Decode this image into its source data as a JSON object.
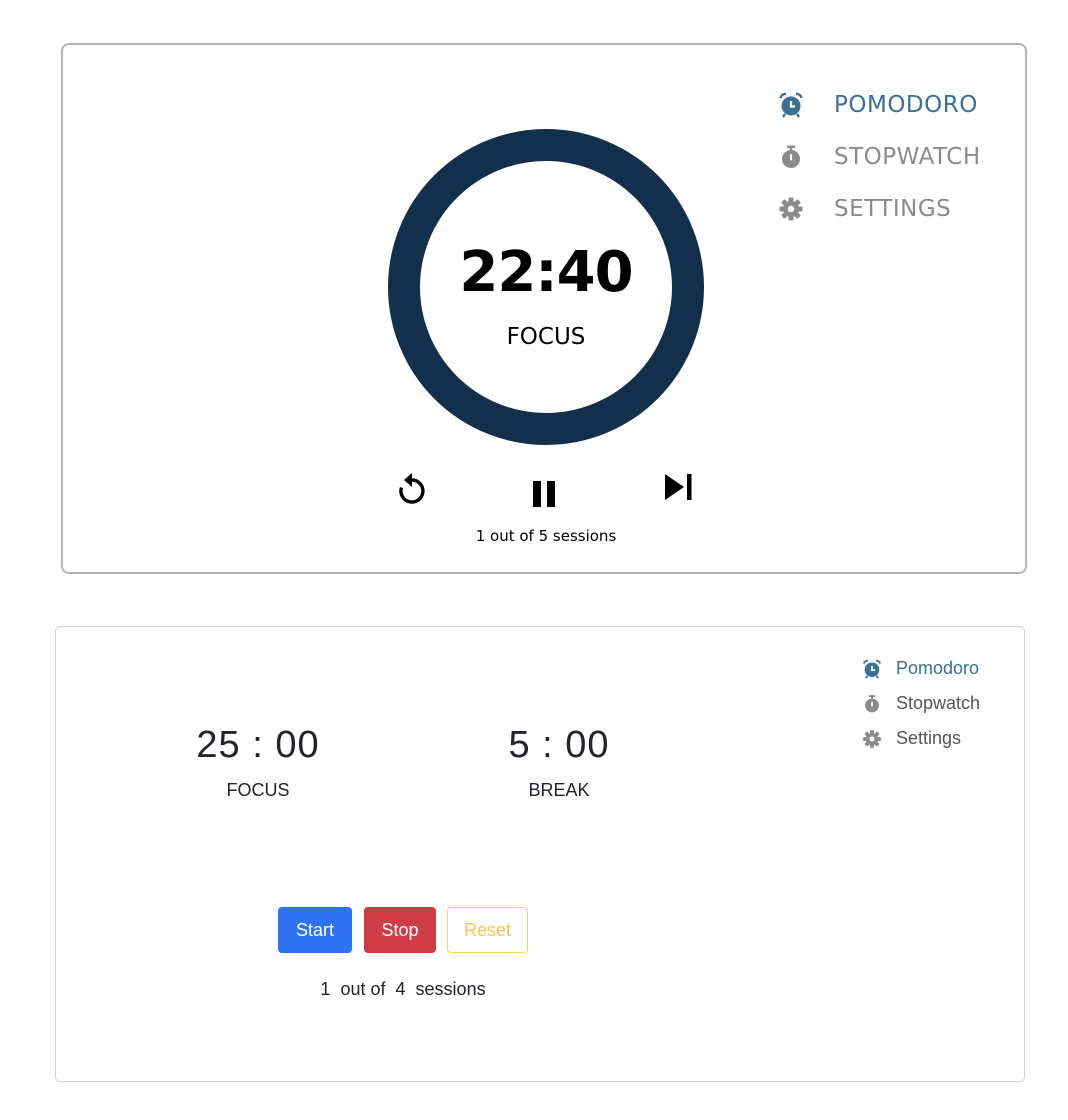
{
  "colors": {
    "ring_dark": "#12304b",
    "ring_progress": "#f5c54d",
    "nav_active": "#3a6f96",
    "nav_inactive": "#8b8b8b",
    "start_bg": "#2f72f3",
    "stop_bg": "#cf3c45",
    "reset_border": "#f7d45c",
    "reset_text": "#f5c54d"
  },
  "timer_v1": {
    "time": "22:40",
    "mode": "FOCUS",
    "elapsed_fraction": 0.093,
    "sessions_text": "1 out of 5 sessions",
    "controls": {
      "restart_icon": "restart-icon",
      "pause_icon": "pause-icon",
      "skip_icon": "skip-next-icon"
    },
    "nav": [
      {
        "label": "POMODORO",
        "icon": "alarm-clock-icon",
        "active": true
      },
      {
        "label": "STOPWATCH",
        "icon": "stopwatch-icon",
        "active": false
      },
      {
        "label": "SETTINGS",
        "icon": "gear-icon",
        "active": false
      }
    ]
  },
  "timer_v2": {
    "focus": {
      "time": "25 : 00",
      "label": "FOCUS"
    },
    "break": {
      "time": "5 : 00",
      "label": "BREAK"
    },
    "buttons": {
      "start": "Start",
      "stop": "Stop",
      "reset": "Reset"
    },
    "sessions": {
      "current": "1",
      "mid": "out of",
      "total": "4",
      "suffix": "sessions"
    },
    "nav": [
      {
        "label": "Pomodoro",
        "icon": "alarm-clock-icon",
        "active": true
      },
      {
        "label": "Stopwatch",
        "icon": "stopwatch-icon",
        "active": false
      },
      {
        "label": "Settings",
        "icon": "gear-icon",
        "active": false
      }
    ]
  }
}
